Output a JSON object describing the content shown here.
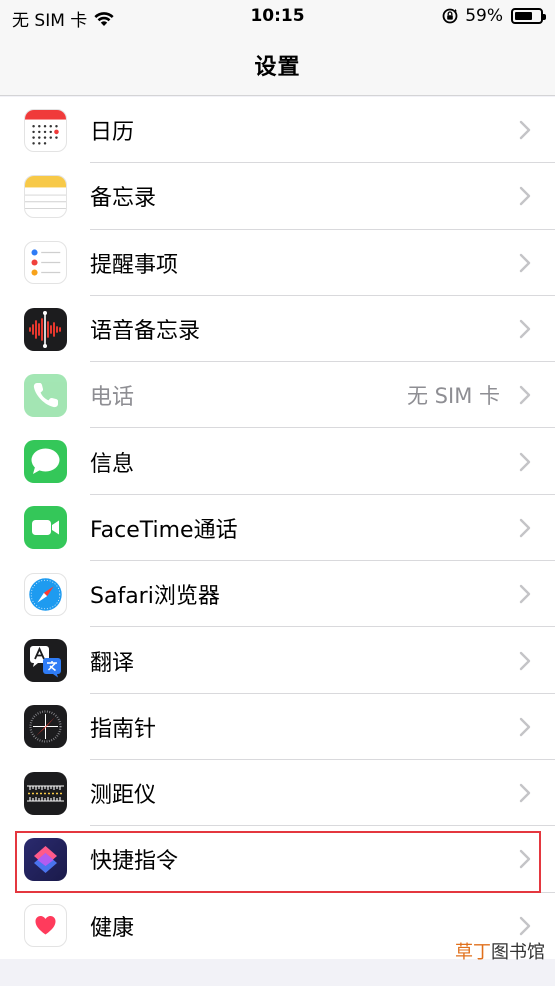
{
  "status_bar": {
    "carrier": "无 SIM 卡",
    "time": "10:15",
    "battery_percent_text": "59%",
    "battery_level": 0.59
  },
  "nav": {
    "title": "设置"
  },
  "rows": [
    {
      "label": "日历",
      "icon": "calendar-icon",
      "detail": "",
      "dim": false
    },
    {
      "label": "备忘录",
      "icon": "notes-icon",
      "detail": "",
      "dim": false
    },
    {
      "label": "提醒事项",
      "icon": "reminders-icon",
      "detail": "",
      "dim": false
    },
    {
      "label": "语音备忘录",
      "icon": "voice-memos-icon",
      "detail": "",
      "dim": false
    },
    {
      "label": "电话",
      "icon": "phone-icon",
      "detail": "无 SIM 卡",
      "dim": true
    },
    {
      "label": "信息",
      "icon": "messages-icon",
      "detail": "",
      "dim": false
    },
    {
      "label": "FaceTime通话",
      "icon": "facetime-icon",
      "detail": "",
      "dim": false
    },
    {
      "label": "Safari浏览器",
      "icon": "safari-icon",
      "detail": "",
      "dim": false
    },
    {
      "label": "翻译",
      "icon": "translate-icon",
      "detail": "",
      "dim": false
    },
    {
      "label": "指南针",
      "icon": "compass-icon",
      "detail": "",
      "dim": false
    },
    {
      "label": "测距仪",
      "icon": "measure-icon",
      "detail": "",
      "dim": false
    },
    {
      "label": "快捷指令",
      "icon": "shortcuts-icon",
      "detail": "",
      "dim": false
    },
    {
      "label": "健康",
      "icon": "health-icon",
      "detail": "",
      "dim": false
    }
  ],
  "watermark": {
    "part1": "草丁",
    "part2": "图书馆"
  },
  "colors": {
    "highlight": "#e4373f",
    "chevron": "#c4c4c7",
    "messages_green": "#34c759",
    "watermark_orange": "#e0701c"
  }
}
